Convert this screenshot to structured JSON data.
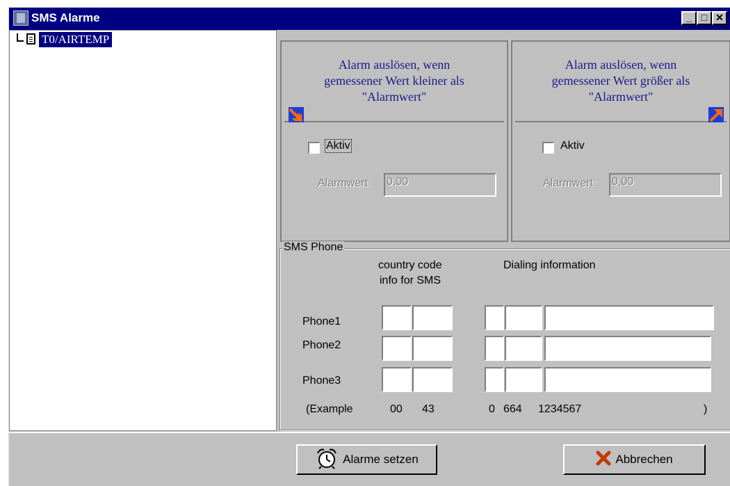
{
  "window": {
    "title": "SMS Alarme",
    "controls": {
      "minimize": "_",
      "maximize": "□",
      "close": "✕"
    }
  },
  "tree": {
    "items": [
      {
        "label": "T0/AIRTEMP",
        "selected": true,
        "icon": "document-icon"
      }
    ]
  },
  "alarm_low": {
    "heading_line1": "Alarm auslösen, wenn",
    "heading_line2": "gemessener Wert kleiner als",
    "heading_line3": "\"Alarmwert\"",
    "icon": "arrow-down-right-icon",
    "active_label": "Aktiv",
    "active_checked": false,
    "value_label": "Alarmwert",
    "value": "0,00"
  },
  "alarm_high": {
    "heading_line1": "Alarm auslösen, wenn",
    "heading_line2": "gemessener Wert größer als",
    "heading_line3": "\"Alarmwert\"",
    "icon": "arrow-up-right-icon",
    "active_label": "Aktiv",
    "active_checked": false,
    "value_label": "Alarmwert",
    "value": "0,00"
  },
  "sms_phone": {
    "legend": "SMS Phone",
    "country_code_header_1": "country code",
    "country_code_header_2": "info for SMS",
    "dialing_header": "Dialing information",
    "phones": [
      {
        "label": "Phone1"
      },
      {
        "label": "Phone2"
      },
      {
        "label": "Phone3"
      }
    ],
    "example": {
      "label": "(Example",
      "cc1": "00",
      "cc2": "43",
      "d1": "0",
      "d2": "664",
      "d3": "1234567",
      "close": ")"
    }
  },
  "buttons": {
    "set_label": "Alarme setzen",
    "set_icon": "alarm-clock-icon",
    "cancel_label": "Abbrechen",
    "cancel_icon": "cross-icon"
  },
  "colors": {
    "titlebar": "#000080",
    "face": "#c0c0c0",
    "heading_text": "#1a1a8a",
    "arrow_blue": "#1b3fd6",
    "arrow_orange": "#ff6a00"
  }
}
